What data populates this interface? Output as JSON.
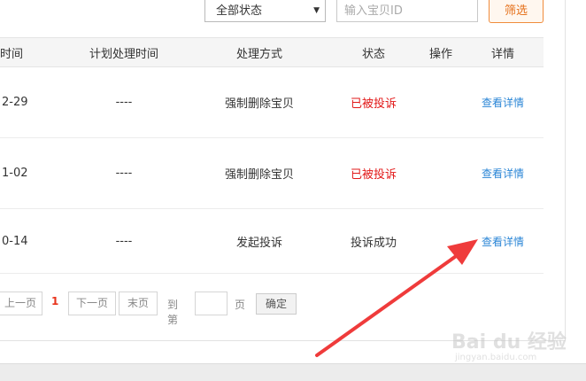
{
  "filters": {
    "status_select": "全部状态",
    "id_placeholder": "输入宝贝ID",
    "filter_button": "筛选"
  },
  "table": {
    "headers": {
      "time": "时间",
      "plan_time": "计划处理时间",
      "method": "处理方式",
      "status": "状态",
      "operation": "操作",
      "detail": "详情"
    },
    "rows": [
      {
        "time": "2-29",
        "plan_time": "----",
        "method": "强制删除宝贝",
        "status": "已被投诉",
        "detail": "查看详情"
      },
      {
        "time": "1-02",
        "plan_time": "----",
        "method": "强制删除宝贝",
        "status": "已被投诉",
        "detail": "查看详情"
      },
      {
        "time": "0-14",
        "plan_time": "----",
        "method": "发起投诉",
        "status": "投诉成功",
        "detail": "查看详情"
      }
    ]
  },
  "pagination": {
    "prev": "上一页",
    "current": "1",
    "next": "下一页",
    "last": "末页",
    "goto": "到第",
    "page": "页",
    "confirm": "确定"
  },
  "watermark": {
    "text": "Bai du 经验",
    "sub": "jingyan.baidu.com"
  },
  "colors": {
    "accent": "#e5701a",
    "complaint_status": "#e21818",
    "link": "#2b86d6",
    "annotation_arrow": "#ef3b3b"
  },
  "icons": {
    "select_caret": "caret-down-icon",
    "annotation": "red-arrow-annotation-icon"
  }
}
